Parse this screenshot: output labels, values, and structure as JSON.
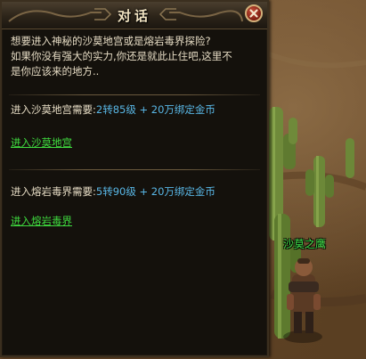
{
  "dialog": {
    "title": "对话",
    "intro_lines": [
      "想要进入神秘的沙莫地宫或是熔岩毒界探险?",
      "如果你没有强大的实力,你还是就此止住吧,这里不",
      "是你应该来的地方.."
    ],
    "option_1": {
      "requirement_label": "进入沙莫地宫需要:",
      "requirement_value": "2转85级 + 20万绑定金币",
      "link_text": "进入沙莫地宫"
    },
    "option_2": {
      "requirement_label": "进入熔岩毒界需要:",
      "requirement_value": "5转90级 + 20万绑定金币",
      "link_text": "进入熔岩毒界"
    },
    "close_icon": "close-icon"
  },
  "world": {
    "npc_name": "沙莫之鹰"
  },
  "colors": {
    "dialog_bg": "#14110c",
    "text": "#e6dcc4",
    "requirement_value": "#59b7e6",
    "link": "#3fdc3f",
    "npc_name": "#3fe04a",
    "title": "#f1e3c2"
  }
}
